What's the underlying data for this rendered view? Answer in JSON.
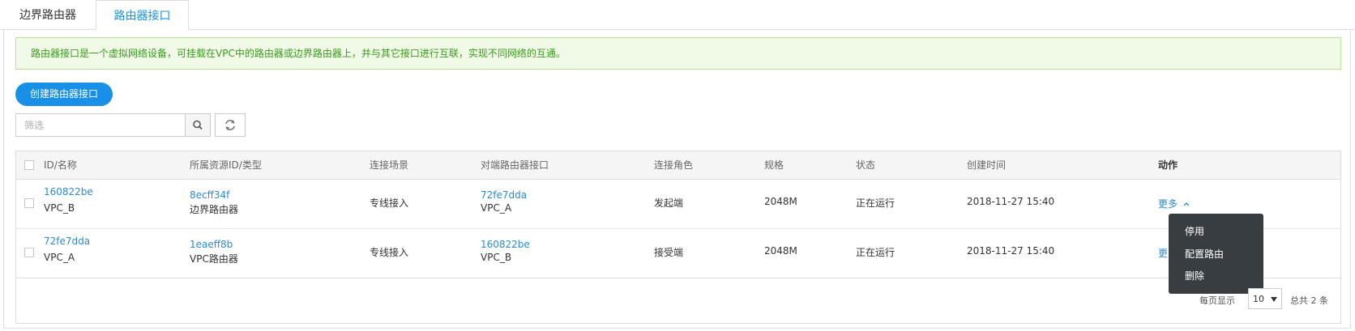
{
  "tabs": [
    {
      "label": "边界路由器"
    },
    {
      "label": "路由器接口"
    }
  ],
  "notice": "路由器接口是一个虚拟网络设备，可挂载在VPC中的路由器或边界路由器上，并与其它接口进行互联，实现不同网络的互通。",
  "create_button": "创建路由器接口",
  "filter": {
    "placeholder": "筛选"
  },
  "columns": [
    "ID/名称",
    "所属资源ID/类型",
    "连接场景",
    "对端路由器接口",
    "连接角色",
    "规格",
    "状态",
    "创建时间",
    "动作"
  ],
  "rows": [
    {
      "id": "160822be",
      "name": "VPC_B",
      "res_id": "8ecff34f",
      "res_type": "边界路由器",
      "scene": "专线接入",
      "peer_id": "72fe7dda",
      "peer_name": "VPC_A",
      "role": "发起端",
      "spec": "2048M",
      "status": "正在运行",
      "created": "2018-11-27 15:40",
      "action": "更多"
    },
    {
      "id": "72fe7dda",
      "name": "VPC_A",
      "res_id": "1eaeff8b",
      "res_type": "VPC路由器",
      "scene": "专线接入",
      "peer_id": "160822be",
      "peer_name": "VPC_B",
      "role": "接受端",
      "spec": "2048M",
      "status": "正在运行",
      "created": "2018-11-27 15:40",
      "action": "更多"
    }
  ],
  "dropdown": [
    "停用",
    "配置路由",
    "删除"
  ],
  "pager": {
    "per_page_label": "每页显示",
    "per_page": "10",
    "total_label": "总共 2 条"
  },
  "colors": {
    "accent": "#1890e8",
    "link": "#2a8ad6",
    "notice_bg": "#f0fae6",
    "notice_text": "#3a9a1d",
    "dropdown_bg": "#373d41"
  },
  "icons": [
    "search-icon",
    "refresh-icon",
    "chevron-up-icon",
    "caret-down-icon"
  ]
}
